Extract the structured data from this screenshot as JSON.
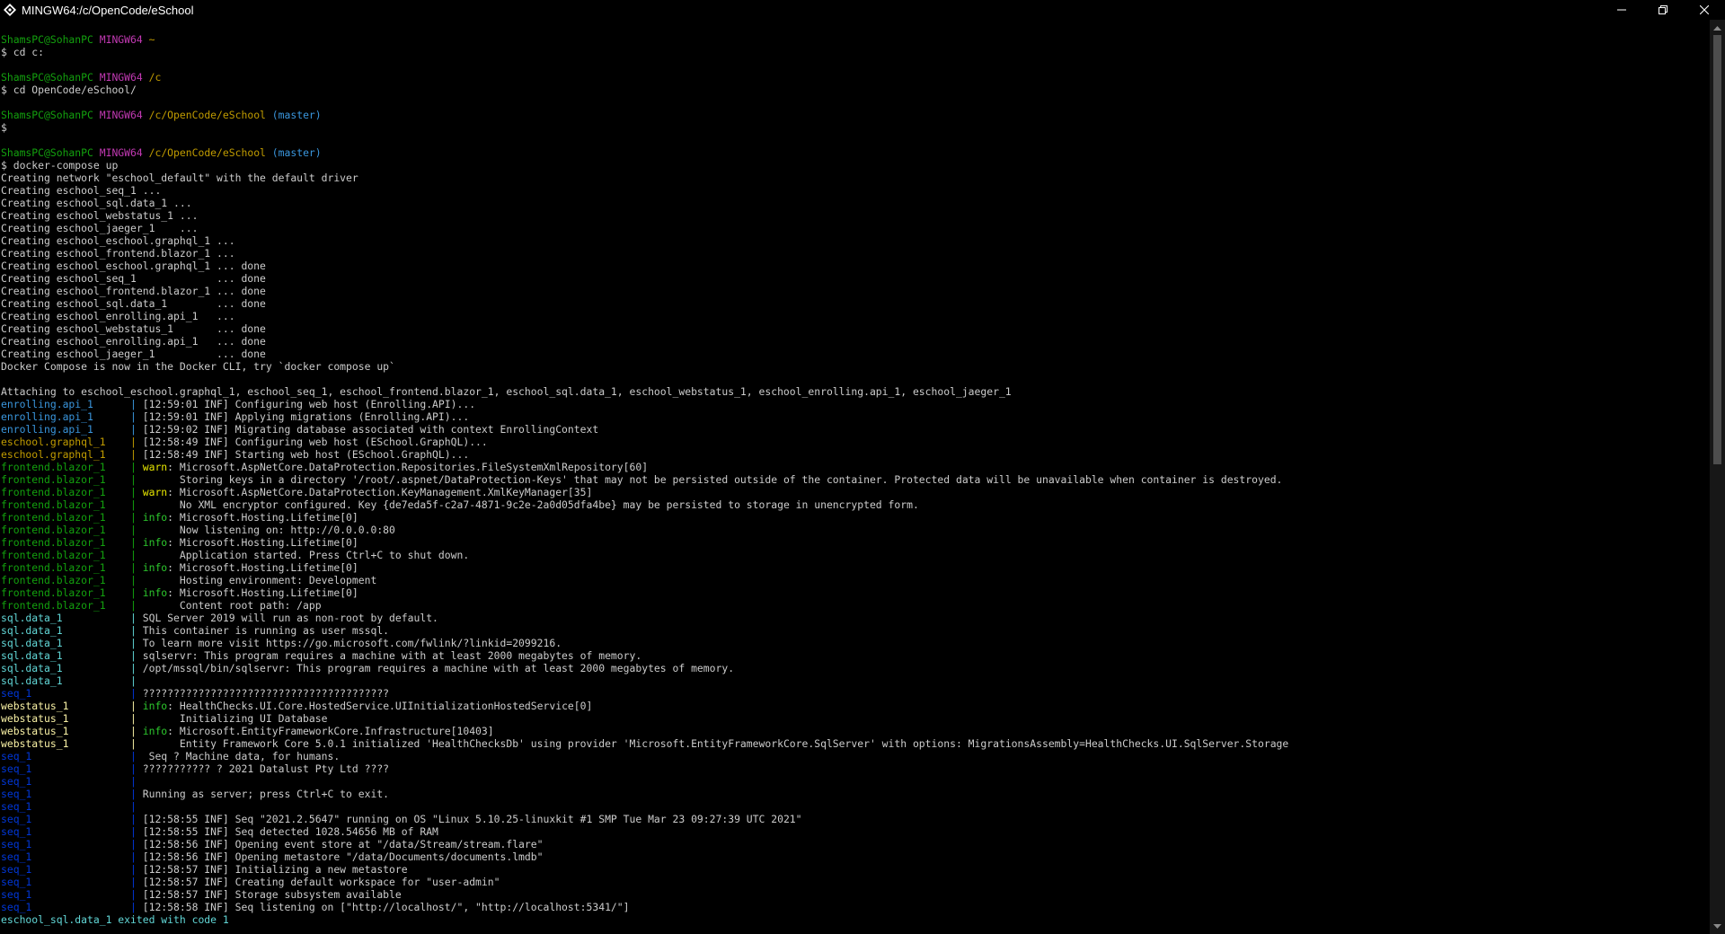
{
  "window": {
    "title": "MINGW64:/c/OpenCode/eSchool",
    "minimize_glyph": "—",
    "maximize_glyph": "❐",
    "close_glyph": "✕"
  },
  "colors": {
    "background": "#000000",
    "text": "#cccccc",
    "prompt_user": "#13a10e",
    "prompt_shell": "#c239b3",
    "prompt_path": "#c19c00",
    "prompt_branch": "#3a96dd"
  },
  "icons": {
    "title": "git-bash-icon"
  },
  "terminal": {
    "lines": [
      [
        {
          "t": "ShamsPC@SohanPC ",
          "c": "green"
        },
        {
          "t": "MINGW64 ",
          "c": "magenta"
        },
        {
          "t": "~",
          "c": "yellow"
        }
      ],
      [
        {
          "t": "$ cd c:",
          "c": "gray"
        }
      ],
      [
        {
          "t": "",
          "c": "gray"
        }
      ],
      [
        {
          "t": "ShamsPC@SohanPC ",
          "c": "green"
        },
        {
          "t": "MINGW64 ",
          "c": "magenta"
        },
        {
          "t": "/c",
          "c": "yellow"
        }
      ],
      [
        {
          "t": "$ cd OpenCode/eSchool/",
          "c": "gray"
        }
      ],
      [
        {
          "t": "",
          "c": "gray"
        }
      ],
      [
        {
          "t": "ShamsPC@SohanPC ",
          "c": "green"
        },
        {
          "t": "MINGW64 ",
          "c": "magenta"
        },
        {
          "t": "/c/OpenCode/eSchool",
          "c": "yellow"
        },
        {
          "t": " (master)",
          "c": "cyan"
        }
      ],
      [
        {
          "t": "$",
          "c": "gray"
        }
      ],
      [
        {
          "t": "",
          "c": "gray"
        }
      ],
      [
        {
          "t": "ShamsPC@SohanPC ",
          "c": "green"
        },
        {
          "t": "MINGW64 ",
          "c": "magenta"
        },
        {
          "t": "/c/OpenCode/eSchool",
          "c": "yellow"
        },
        {
          "t": " (master)",
          "c": "cyan"
        }
      ],
      [
        {
          "t": "$ docker-compose up",
          "c": "gray"
        }
      ],
      [
        {
          "t": "Creating network \"eschool_default\" with the default driver",
          "c": "gray"
        }
      ],
      [
        {
          "t": "Creating eschool_seq_1 ...",
          "c": "gray"
        }
      ],
      [
        {
          "t": "Creating eschool_sql.data_1 ...",
          "c": "gray"
        }
      ],
      [
        {
          "t": "Creating eschool_webstatus_1 ...",
          "c": "gray"
        }
      ],
      [
        {
          "t": "Creating eschool_jaeger_1    ...",
          "c": "gray"
        }
      ],
      [
        {
          "t": "Creating eschool_eschool.graphql_1 ...",
          "c": "gray"
        }
      ],
      [
        {
          "t": "Creating eschool_frontend.blazor_1 ...",
          "c": "gray"
        }
      ],
      [
        {
          "t": "Creating eschool_eschool.graphql_1 ... done",
          "c": "gray"
        }
      ],
      [
        {
          "t": "Creating eschool_seq_1             ... done",
          "c": "gray"
        }
      ],
      [
        {
          "t": "Creating eschool_frontend.blazor_1 ... done",
          "c": "gray"
        }
      ],
      [
        {
          "t": "Creating eschool_sql.data_1        ... done",
          "c": "gray"
        }
      ],
      [
        {
          "t": "Creating eschool_enrolling.api_1   ...",
          "c": "gray"
        }
      ],
      [
        {
          "t": "Creating eschool_webstatus_1       ... done",
          "c": "gray"
        }
      ],
      [
        {
          "t": "Creating eschool_enrolling.api_1   ... done",
          "c": "gray"
        }
      ],
      [
        {
          "t": "Creating eschool_jaeger_1          ... done",
          "c": "gray"
        }
      ],
      [
        {
          "t": "Docker Compose is now in the Docker CLI, try `docker compose up`",
          "c": "gray"
        }
      ],
      [
        {
          "t": "",
          "c": "gray"
        }
      ],
      [
        {
          "t": "Attaching to eschool_eschool.graphql_1, eschool_seq_1, eschool_frontend.blazor_1, eschool_sql.data_1, eschool_webstatus_1, eschool_enrolling.api_1, eschool_jaeger_1",
          "c": "gray"
        }
      ],
      [
        {
          "t": "enrolling.api_1      ",
          "c": "cyan"
        },
        {
          "t": "| ",
          "c": "cyan"
        },
        {
          "t": "[12:59:01 INF] Configuring web host (Enrolling.API)...",
          "c": "gray"
        }
      ],
      [
        {
          "t": "enrolling.api_1      ",
          "c": "cyan"
        },
        {
          "t": "| ",
          "c": "cyan"
        },
        {
          "t": "[12:59:01 INF] Applying migrations (Enrolling.API)...",
          "c": "gray"
        }
      ],
      [
        {
          "t": "enrolling.api_1      ",
          "c": "cyan"
        },
        {
          "t": "| ",
          "c": "cyan"
        },
        {
          "t": "[12:59:02 INF] Migrating database associated with context EnrollingContext",
          "c": "gray"
        }
      ],
      [
        {
          "t": "eschool.graphql_1    ",
          "c": "yellow"
        },
        {
          "t": "| ",
          "c": "yellow"
        },
        {
          "t": "[12:58:49 INF] Configuring web host (ESchool.GraphQL)...",
          "c": "gray"
        }
      ],
      [
        {
          "t": "eschool.graphql_1    ",
          "c": "yellow"
        },
        {
          "t": "| ",
          "c": "yellow"
        },
        {
          "t": "[12:58:49 INF] Starting web host (ESchool.GraphQL)...",
          "c": "gray"
        }
      ],
      [
        {
          "t": "frontend.blazor_1    ",
          "c": "green"
        },
        {
          "t": "| ",
          "c": "green"
        },
        {
          "t": "warn",
          "c": "byel2"
        },
        {
          "t": ": Microsoft.AspNetCore.DataProtection.Repositories.FileSystemXmlRepository[60]",
          "c": "gray"
        }
      ],
      [
        {
          "t": "frontend.blazor_1    ",
          "c": "green"
        },
        {
          "t": "| ",
          "c": "green"
        },
        {
          "t": "      Storing keys in a directory '/root/.aspnet/DataProtection-Keys' that may not be persisted outside of the container. Protected data will be unavailable when container is destroyed.",
          "c": "gray"
        }
      ],
      [
        {
          "t": "frontend.blazor_1    ",
          "c": "green"
        },
        {
          "t": "| ",
          "c": "green"
        },
        {
          "t": "warn",
          "c": "byel2"
        },
        {
          "t": ": Microsoft.AspNetCore.DataProtection.KeyManagement.XmlKeyManager[35]",
          "c": "gray"
        }
      ],
      [
        {
          "t": "frontend.blazor_1    ",
          "c": "green"
        },
        {
          "t": "| ",
          "c": "green"
        },
        {
          "t": "      No XML encryptor configured. Key {de7eda5f-c2a7-4871-9c2e-2a0d05dfa4be} may be persisted to storage in unencrypted form.",
          "c": "gray"
        }
      ],
      [
        {
          "t": "frontend.blazor_1    ",
          "c": "green"
        },
        {
          "t": "| ",
          "c": "green"
        },
        {
          "t": "info",
          "c": "lgreen"
        },
        {
          "t": ": Microsoft.Hosting.Lifetime[0]",
          "c": "gray"
        }
      ],
      [
        {
          "t": "frontend.blazor_1    ",
          "c": "green"
        },
        {
          "t": "| ",
          "c": "green"
        },
        {
          "t": "      Now listening on: http://0.0.0.0:80",
          "c": "gray"
        }
      ],
      [
        {
          "t": "frontend.blazor_1    ",
          "c": "green"
        },
        {
          "t": "| ",
          "c": "green"
        },
        {
          "t": "info",
          "c": "lgreen"
        },
        {
          "t": ": Microsoft.Hosting.Lifetime[0]",
          "c": "gray"
        }
      ],
      [
        {
          "t": "frontend.blazor_1    ",
          "c": "green"
        },
        {
          "t": "| ",
          "c": "green"
        },
        {
          "t": "      Application started. Press Ctrl+C to shut down.",
          "c": "gray"
        }
      ],
      [
        {
          "t": "frontend.blazor_1    ",
          "c": "green"
        },
        {
          "t": "| ",
          "c": "green"
        },
        {
          "t": "info",
          "c": "lgreen"
        },
        {
          "t": ": Microsoft.Hosting.Lifetime[0]",
          "c": "gray"
        }
      ],
      [
        {
          "t": "frontend.blazor_1    ",
          "c": "green"
        },
        {
          "t": "| ",
          "c": "green"
        },
        {
          "t": "      Hosting environment: Development",
          "c": "gray"
        }
      ],
      [
        {
          "t": "frontend.blazor_1    ",
          "c": "green"
        },
        {
          "t": "| ",
          "c": "green"
        },
        {
          "t": "info",
          "c": "lgreen"
        },
        {
          "t": ": Microsoft.Hosting.Lifetime[0]",
          "c": "gray"
        }
      ],
      [
        {
          "t": "frontend.blazor_1    ",
          "c": "green"
        },
        {
          "t": "| ",
          "c": "green"
        },
        {
          "t": "      Content root path: /app",
          "c": "gray"
        }
      ],
      [
        {
          "t": "sql.data_1           ",
          "c": "bcyan"
        },
        {
          "t": "| ",
          "c": "bcyan"
        },
        {
          "t": "SQL Server 2019 will run as non-root by default.",
          "c": "gray"
        }
      ],
      [
        {
          "t": "sql.data_1           ",
          "c": "bcyan"
        },
        {
          "t": "| ",
          "c": "bcyan"
        },
        {
          "t": "This container is running as user mssql.",
          "c": "gray"
        }
      ],
      [
        {
          "t": "sql.data_1           ",
          "c": "bcyan"
        },
        {
          "t": "| ",
          "c": "bcyan"
        },
        {
          "t": "To learn more visit https://go.microsoft.com/fwlink/?linkid=2099216.",
          "c": "gray"
        }
      ],
      [
        {
          "t": "sql.data_1           ",
          "c": "bcyan"
        },
        {
          "t": "| ",
          "c": "bcyan"
        },
        {
          "t": "sqlservr: This program requires a machine with at least 2000 megabytes of memory.",
          "c": "gray"
        }
      ],
      [
        {
          "t": "sql.data_1           ",
          "c": "bcyan"
        },
        {
          "t": "| ",
          "c": "bcyan"
        },
        {
          "t": "/opt/mssql/bin/sqlservr: This program requires a machine with at least 2000 megabytes of memory.",
          "c": "gray"
        }
      ],
      [
        {
          "t": "sql.data_1           ",
          "c": "bcyan"
        },
        {
          "t": "|",
          "c": "bcyan"
        }
      ],
      [
        {
          "t": "seq_1                ",
          "c": "blue"
        },
        {
          "t": "| ",
          "c": "blue"
        },
        {
          "t": "????????????????????????????????????????",
          "c": "gray"
        }
      ],
      [
        {
          "t": "webstatus_1          ",
          "c": "byellow"
        },
        {
          "t": "| ",
          "c": "byellow"
        },
        {
          "t": "info",
          "c": "lgreen"
        },
        {
          "t": ": HealthChecks.UI.Core.HostedService.UIInitializationHostedService[0]",
          "c": "gray"
        }
      ],
      [
        {
          "t": "webstatus_1          ",
          "c": "byellow"
        },
        {
          "t": "| ",
          "c": "byellow"
        },
        {
          "t": "      Initializing UI Database",
          "c": "gray"
        }
      ],
      [
        {
          "t": "webstatus_1          ",
          "c": "byellow"
        },
        {
          "t": "| ",
          "c": "byellow"
        },
        {
          "t": "info",
          "c": "lgreen"
        },
        {
          "t": ": Microsoft.EntityFrameworkCore.Infrastructure[10403]",
          "c": "gray"
        }
      ],
      [
        {
          "t": "webstatus_1          ",
          "c": "byellow"
        },
        {
          "t": "| ",
          "c": "byellow"
        },
        {
          "t": "      Entity Framework Core 5.0.1 initialized 'HealthChecksDb' using provider 'Microsoft.EntityFrameworkCore.SqlServer' with options: MigrationsAssembly=HealthChecks.UI.SqlServer.Storage",
          "c": "gray"
        }
      ],
      [
        {
          "t": "seq_1                ",
          "c": "blue"
        },
        {
          "t": "| ",
          "c": "blue"
        },
        {
          "t": " Seq ? Machine data, for humans.",
          "c": "gray"
        }
      ],
      [
        {
          "t": "seq_1                ",
          "c": "blue"
        },
        {
          "t": "| ",
          "c": "blue"
        },
        {
          "t": "??????????? ? 2021 Datalust Pty Ltd ????",
          "c": "gray"
        }
      ],
      [
        {
          "t": "seq_1                ",
          "c": "blue"
        },
        {
          "t": "|",
          "c": "blue"
        }
      ],
      [
        {
          "t": "seq_1                ",
          "c": "blue"
        },
        {
          "t": "| ",
          "c": "blue"
        },
        {
          "t": "Running as server; press Ctrl+C to exit.",
          "c": "gray"
        }
      ],
      [
        {
          "t": "seq_1                ",
          "c": "blue"
        },
        {
          "t": "|",
          "c": "blue"
        }
      ],
      [
        {
          "t": "seq_1                ",
          "c": "blue"
        },
        {
          "t": "| ",
          "c": "blue"
        },
        {
          "t": "[12:58:55 INF] Seq \"2021.2.5647\" running on OS \"Linux 5.10.25-linuxkit #1 SMP Tue Mar 23 09:27:39 UTC 2021\"",
          "c": "gray"
        }
      ],
      [
        {
          "t": "seq_1                ",
          "c": "blue"
        },
        {
          "t": "| ",
          "c": "blue"
        },
        {
          "t": "[12:58:55 INF] Seq detected 1028.54656 MB of RAM",
          "c": "gray"
        }
      ],
      [
        {
          "t": "seq_1                ",
          "c": "blue"
        },
        {
          "t": "| ",
          "c": "blue"
        },
        {
          "t": "[12:58:56 INF] Opening event store at \"/data/Stream/stream.flare\"",
          "c": "gray"
        }
      ],
      [
        {
          "t": "seq_1                ",
          "c": "blue"
        },
        {
          "t": "| ",
          "c": "blue"
        },
        {
          "t": "[12:58:56 INF] Opening metastore \"/data/Documents/documents.lmdb\"",
          "c": "gray"
        }
      ],
      [
        {
          "t": "seq_1                ",
          "c": "blue"
        },
        {
          "t": "| ",
          "c": "blue"
        },
        {
          "t": "[12:58:57 INF] Initializing a new metastore",
          "c": "gray"
        }
      ],
      [
        {
          "t": "seq_1                ",
          "c": "blue"
        },
        {
          "t": "| ",
          "c": "blue"
        },
        {
          "t": "[12:58:57 INF] Creating default workspace for \"user-admin\"",
          "c": "gray"
        }
      ],
      [
        {
          "t": "seq_1                ",
          "c": "blue"
        },
        {
          "t": "| ",
          "c": "blue"
        },
        {
          "t": "[12:58:57 INF] Storage subsystem available",
          "c": "gray"
        }
      ],
      [
        {
          "t": "seq_1                ",
          "c": "blue"
        },
        {
          "t": "| ",
          "c": "blue"
        },
        {
          "t": "[12:58:58 INF] Seq listening on [\"http://localhost/\", \"http://localhost:5341/\"]",
          "c": "gray"
        }
      ],
      [
        {
          "t": "eschool_sql.data_1 exited with code 1",
          "c": "bcyan"
        }
      ]
    ]
  }
}
